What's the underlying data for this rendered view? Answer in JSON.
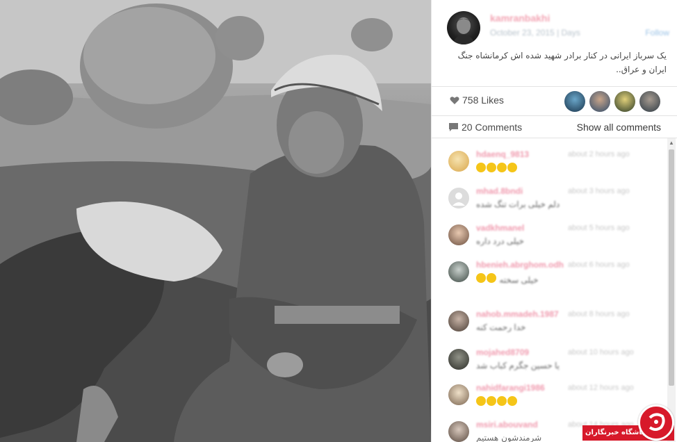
{
  "photo": {
    "icon": "war-photo"
  },
  "post": {
    "username": "kamranbakhi",
    "date": "October 23, 2015 | Days",
    "follow_label": "Follow",
    "caption": "یک سرباز ایرانی در کنار برادر شهید شده اش کرمانشاه جنگ ایران و عراق.."
  },
  "likes": {
    "label": "758 Likes",
    "icon": "heart-icon"
  },
  "comments_bar": {
    "label": "20 Comments",
    "icon": "comment-icon",
    "show_all": "Show all comments"
  },
  "comments": [
    {
      "user": "hdaenq_9813",
      "time": "about 2 hours ago",
      "text": "",
      "emoji_count": 4,
      "avatar": "#e9c27a"
    },
    {
      "user": "mhad.8bndi",
      "time": "about 3 hours ago",
      "text": "دلم خیلی برات تنگ شده",
      "emoji_count": 0,
      "avatar": "#d8d8d8"
    },
    {
      "user": "vadkhmanel",
      "time": "about 5 hours ago",
      "text": "خیلی درد داره",
      "emoji_count": 0,
      "avatar": "#cfa48c"
    },
    {
      "user": "hbenieh.abrghom.odh",
      "time": "about 6 hours ago",
      "text": "خیلی سخته",
      "emoji_count": 2,
      "avatar": "#6e7a72"
    },
    {
      "user": "nahob.mmadeh.1987",
      "time": "about 8 hours ago",
      "text": "خدا رحمت کنه",
      "emoji_count": 0,
      "avatar": "#8b7b70"
    },
    {
      "user": "mojahed8709",
      "time": "about 10 hours ago",
      "text": "یا حسین جگرم کباب شد",
      "emoji_count": 0,
      "avatar": "#56574f"
    },
    {
      "user": "nahidfarangi1986",
      "time": "about 12 hours ago",
      "text": "",
      "emoji_count": 4,
      "avatar": "#c9b59e"
    },
    {
      "user": "msiri.abouvand",
      "time": "about 14 hours ago",
      "text": "شرمندشون هستیم",
      "emoji_count": 0,
      "avatar": "#9e8f86"
    }
  ],
  "watermark": {
    "label": "باشگاه خبرنگاران",
    "icon": "ycn-logo-icon"
  },
  "colors": {
    "username": "#f09aae",
    "badge": "#d7192a"
  }
}
